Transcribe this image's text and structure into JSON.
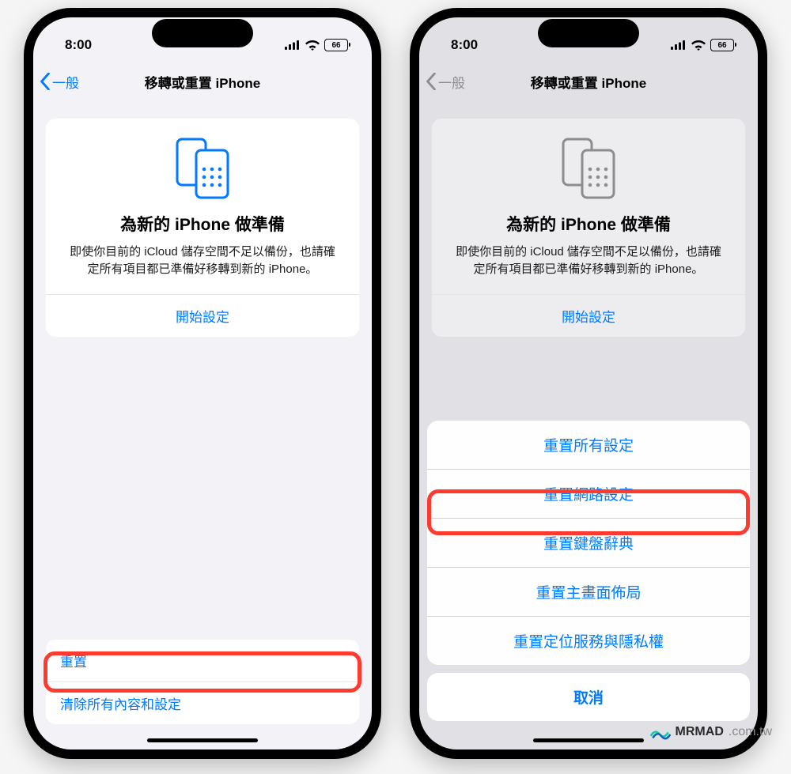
{
  "status": {
    "time": "8:00",
    "battery": "66"
  },
  "phoneA": {
    "nav": {
      "back": "一般",
      "title": "移轉或重置 iPhone"
    },
    "card": {
      "title": "為新的 iPhone 做準備",
      "desc": "即使你目前的 iCloud 儲存空間不足以備份，也請確定所有項目都已準備好移轉到新的 iPhone。",
      "action": "開始設定"
    },
    "bottom": {
      "reset": "重置",
      "erase": "清除所有內容和設定"
    }
  },
  "phoneB": {
    "nav": {
      "back": "一般",
      "title": "移轉或重置 iPhone"
    },
    "card": {
      "title": "為新的 iPhone 做準備",
      "desc": "即使你目前的 iCloud 儲存空間不足以備份，也請確定所有項目都已準備好移轉到新的 iPhone。",
      "action": "開始設定"
    },
    "sheet": {
      "options": [
        "重置所有設定",
        "重置網路設定",
        "重置鍵盤辭典",
        "重置主畫面佈局",
        "重置定位服務與隱私權"
      ],
      "cancel": "取消"
    }
  },
  "watermark": {
    "brand": "MRMAD",
    "domain": ".com.tw"
  }
}
